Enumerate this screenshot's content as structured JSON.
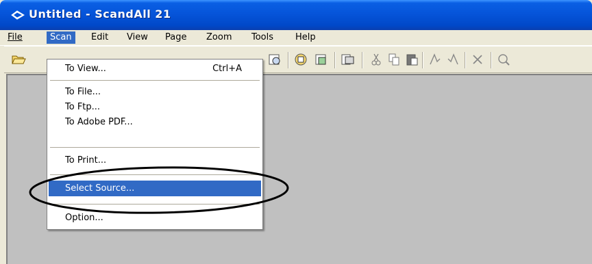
{
  "window": {
    "title": "Untitled - ScandAll 21",
    "app_icon": "scanner-app-icon"
  },
  "menubar": {
    "items": [
      {
        "label": "File",
        "active": false
      },
      {
        "label": "Scan",
        "active": true
      },
      {
        "label": "Edit",
        "active": false
      },
      {
        "label": "View",
        "active": false
      },
      {
        "label": "Page",
        "active": false
      },
      {
        "label": "Zoom",
        "active": false
      },
      {
        "label": "Tools",
        "active": false
      },
      {
        "label": "Help",
        "active": false
      }
    ]
  },
  "toolbar": {
    "icons": [
      "open-folder-icon",
      "scan-to-view-icon",
      "scan-to-file-icon",
      "scan-to-ftp-icon",
      "scan-to-pdf-icon",
      "scan-to-print-icon",
      "cut-icon",
      "copy-icon",
      "paste-icon",
      "rotate-left-icon",
      "rotate-right-icon",
      "delete-icon",
      "zoom-icon"
    ]
  },
  "scan_menu": {
    "items": [
      {
        "label": "To View...",
        "shortcut": "Ctrl+A"
      },
      {
        "label": "To File..."
      },
      {
        "label": "To Ftp..."
      },
      {
        "label": "To Adobe PDF..."
      },
      {
        "label": "To Print..."
      },
      {
        "label": "Select Source...",
        "selected": true
      },
      {
        "label": "Option..."
      }
    ]
  },
  "colors": {
    "title_bar": "#0553d8",
    "menu_highlight": "#316ac5",
    "client_bg": "#c0c0c0",
    "chrome": "#ece9d8"
  }
}
